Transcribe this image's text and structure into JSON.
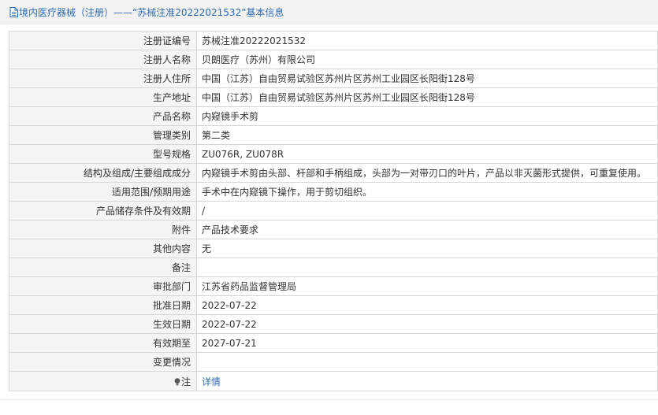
{
  "header": {
    "title": "境内医疗器械（注册）——“苏械注准20222021532”基本信息"
  },
  "rows": [
    {
      "label": "注册证编号",
      "value": "苏械注准20222021532"
    },
    {
      "label": "注册人名称",
      "value": "贝朗医疗（苏州）有限公司"
    },
    {
      "label": "注册人住所",
      "value": "中国（江苏）自由贸易试验区苏州片区苏州工业园区长阳街128号"
    },
    {
      "label": "生产地址",
      "value": "中国（江苏）自由贸易试验区苏州片区苏州工业园区长阳街128号"
    },
    {
      "label": "产品名称",
      "value": "内窥镜手术剪"
    },
    {
      "label": "管理类别",
      "value": "第二类"
    },
    {
      "label": "型号规格",
      "value": "ZU076R, ZU078R"
    },
    {
      "label": "结构及组成/主要组成成分",
      "value": "内窥镜手术剪由头部、杆部和手柄组成，头部为一对带刃口的叶片，产品以非灭菌形式提供，可重复使用。"
    },
    {
      "label": "适用范围/预期用途",
      "value": "手术中在内窥镜下操作，用于剪切组织。"
    },
    {
      "label": "产品储存条件及有效期",
      "value": "/"
    },
    {
      "label": "附件",
      "value": "产品技术要求"
    },
    {
      "label": "其他内容",
      "value": "无"
    },
    {
      "label": "备注",
      "value": ""
    },
    {
      "label": "审批部门",
      "value": "江苏省药品监督管理局"
    },
    {
      "label": "批准日期",
      "value": "2022-07-22"
    },
    {
      "label": "生效日期",
      "value": "2022-07-22"
    },
    {
      "label": "有效期至",
      "value": "2027-07-21"
    },
    {
      "label": "变更情况",
      "value": ""
    }
  ],
  "note_row": {
    "label": "注",
    "link": "详情",
    "icon": "lightbulb-icon"
  },
  "colors": {
    "accent": "#2f6cb0",
    "label_bg": "#f5f5f5",
    "border": "#d7d7d7"
  }
}
